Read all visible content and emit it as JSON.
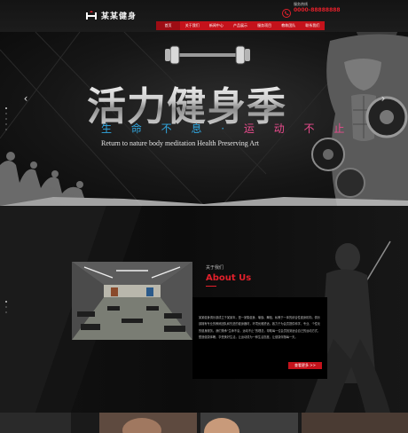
{
  "header": {
    "logo_text": "某某健身",
    "hotline_label": "服务热线",
    "hotline_number": "0000-88888888",
    "nav": [
      "首页",
      "关于我们",
      "新闻中心",
      "产品展示",
      "服务项目",
      "教练团队",
      "联系我们"
    ],
    "active_nav": 0
  },
  "banner": {
    "headline": "活力健身季",
    "slogan_part1": "生 命 不 息 ·",
    "slogan_part2": "运 动 不 止",
    "subline": "Return to nature  body meditation  Health Preserving Art",
    "prev_icon": "chevron-left-icon",
    "next_icon": "chevron-right-icon"
  },
  "about": {
    "subtitle": "关于我们",
    "title": "About Us",
    "description": "某某健身俱乐部成立于某某年，是一家集健身、瑜伽、舞蹈、私教于一体的综合性健身机构。俱乐部拥有专业的教练团队和先进的健身器材，环境优雅舒适，致力于为会员提供科学、专业、个性化的健身服务。我们秉承“生命不息，运动不止”的理念，帮助每一位会员找到适合自己的运动方式，塑造健康体魄，享受美好生活，让运动成为一种生活态度，让健康伴随每一天。",
    "more_label": "查看更多 >>"
  },
  "colors": {
    "accent": "#c4121b",
    "highlight": "#e2202b",
    "slogan_blue": "#31a7e0",
    "slogan_pink": "#e84b8c"
  }
}
